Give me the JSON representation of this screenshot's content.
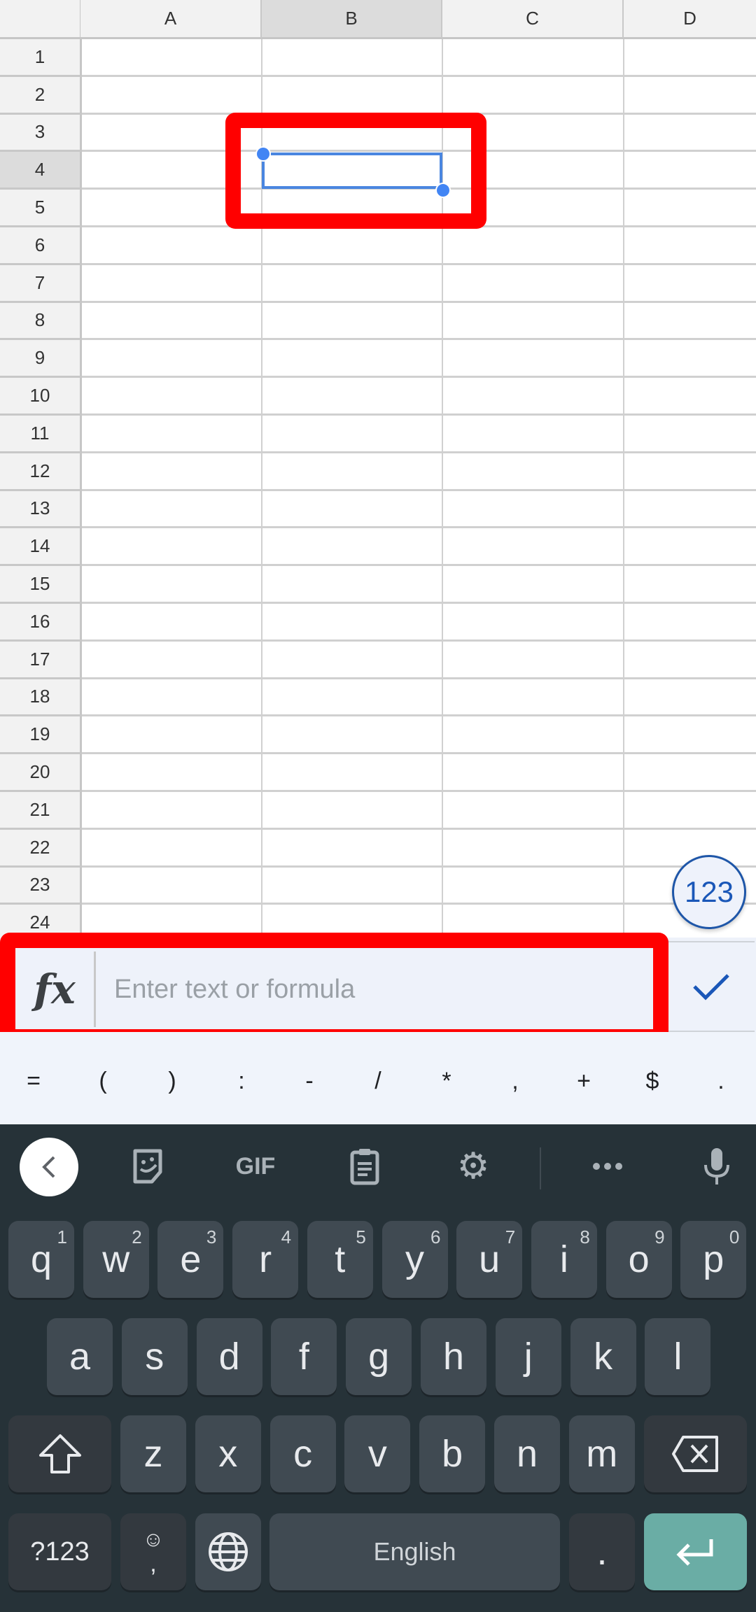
{
  "sheet": {
    "columns": [
      {
        "label": "A",
        "selected": false
      },
      {
        "label": "B",
        "selected": true
      },
      {
        "label": "C",
        "selected": false
      },
      {
        "label": "D",
        "selected": false
      }
    ],
    "rows": [
      "1",
      "2",
      "3",
      "4",
      "5",
      "6",
      "7",
      "8",
      "9",
      "10",
      "11",
      "12",
      "13",
      "14",
      "15",
      "16",
      "17",
      "18",
      "19",
      "20",
      "21",
      "22",
      "23",
      "24"
    ],
    "selected_row": "4",
    "selected_cell": "B4",
    "selection_color": "#4285f4"
  },
  "annotations": {
    "highlight_color": "#ff0000"
  },
  "number_format_button": {
    "label": "123"
  },
  "formula_bar": {
    "fx_label": "fx",
    "placeholder": "Enter text or formula",
    "value": "",
    "confirm_icon": "check-icon"
  },
  "symbol_bar": {
    "symbols": [
      "=",
      "(",
      ")",
      ":",
      "-",
      "/",
      "*",
      ",",
      "+",
      "$",
      "."
    ]
  },
  "keyboard": {
    "toolbar": [
      {
        "name": "back",
        "icon": "chevron-left-icon"
      },
      {
        "name": "sticker",
        "icon": "sticker-icon"
      },
      {
        "name": "gif",
        "label": "GIF"
      },
      {
        "name": "clipboard",
        "icon": "clipboard-icon"
      },
      {
        "name": "settings",
        "icon": "gear-icon"
      },
      {
        "name": "more",
        "icon": "more-icon"
      },
      {
        "name": "voice",
        "icon": "microphone-icon"
      }
    ],
    "row1": [
      {
        "key": "q",
        "hint": "1"
      },
      {
        "key": "w",
        "hint": "2"
      },
      {
        "key": "e",
        "hint": "3"
      },
      {
        "key": "r",
        "hint": "4"
      },
      {
        "key": "t",
        "hint": "5"
      },
      {
        "key": "y",
        "hint": "6"
      },
      {
        "key": "u",
        "hint": "7"
      },
      {
        "key": "i",
        "hint": "8"
      },
      {
        "key": "o",
        "hint": "9"
      },
      {
        "key": "p",
        "hint": "0"
      }
    ],
    "row2": [
      "a",
      "s",
      "d",
      "f",
      "g",
      "h",
      "j",
      "k",
      "l"
    ],
    "row3": [
      "z",
      "x",
      "c",
      "v",
      "b",
      "n",
      "m"
    ],
    "symbols_key": "?123",
    "comma_key": ",",
    "space_label": "English",
    "period_key": ".",
    "enter_color": "#6aada5"
  }
}
